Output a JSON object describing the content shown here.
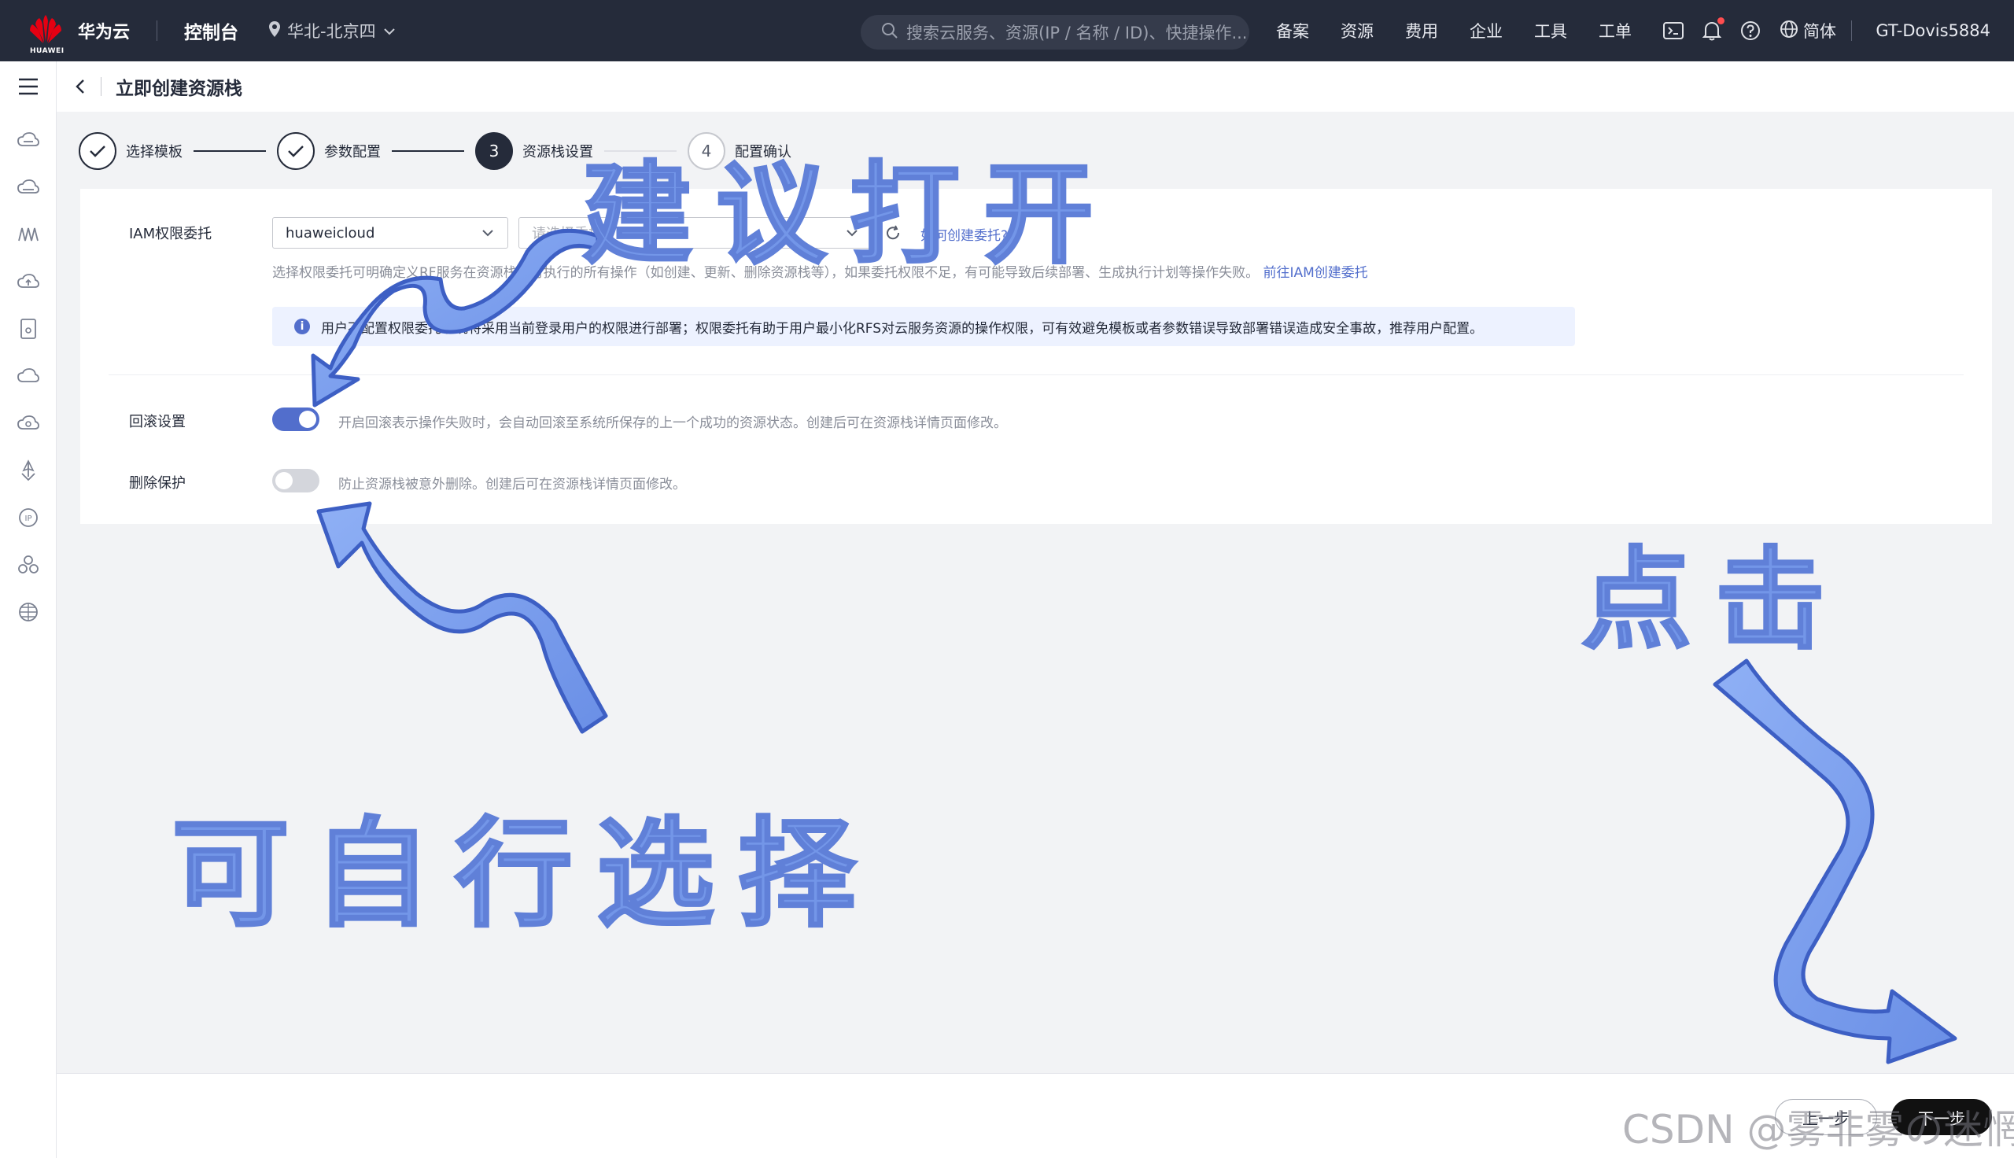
{
  "topbar": {
    "logo_text": "HUAWEI",
    "brand": "华为云",
    "console": "控制台",
    "region": "华北-北京四",
    "search_placeholder": "搜索云服务、资源(IP / 名称 / ID)、快捷操作...",
    "nav": [
      "备案",
      "资源",
      "费用",
      "企业",
      "工具",
      "工单"
    ],
    "lang": "简体",
    "user": "GT-Dovis5884"
  },
  "page": {
    "title": "立即创建资源栈"
  },
  "steps": [
    {
      "label": "选择模板",
      "state": "done"
    },
    {
      "label": "参数配置",
      "state": "done"
    },
    {
      "label": "资源栈设置",
      "state": "active",
      "number": "3"
    },
    {
      "label": "配置确认",
      "state": "todo",
      "number": "4"
    }
  ],
  "form": {
    "iam_label": "IAM权限委托",
    "iam_select_value": "huaweicloud",
    "iam_agency_placeholder": "请选择委托",
    "iam_help_link": "如何创建委托?",
    "iam_hint": "选择权限委托可明确定义RF服务在资源栈上可执行的所有操作（如创建、更新、删除资源栈等），如果委托权限不足，有可能导致后续部署、生成执行计划等操作失败。",
    "iam_hint_link": "前往IAM创建委托",
    "info_text": "用户不配置权限委托系统将采用当前登录用户的权限进行部署；权限委托有助于用户最小化RFS对云服务资源的操作权限，可有效避免模板或者参数错误导致部署错误造成安全事故，推荐用户配置。",
    "rollback_label": "回滚设置",
    "rollback_on": true,
    "rollback_hint": "开启回滚表示操作失败时，会自动回滚至系统所保存的上一个成功的资源状态。创建后可在资源栈详情页面修改。",
    "delete_label": "删除保护",
    "delete_on": false,
    "delete_hint": "防止资源栈被意外删除。创建后可在资源栈详情页面修改。"
  },
  "footer": {
    "prev": "上一步",
    "next": "下一步"
  },
  "annotations": {
    "top": "建议打开",
    "left": "可自行选择",
    "right": "点击",
    "color": "#7396e8"
  },
  "watermark": "CSDN @雾非雾の迷惘",
  "colors": {
    "topbar": "#252b3a",
    "accent": "#526ecc",
    "info_bg": "#edf2ff"
  }
}
